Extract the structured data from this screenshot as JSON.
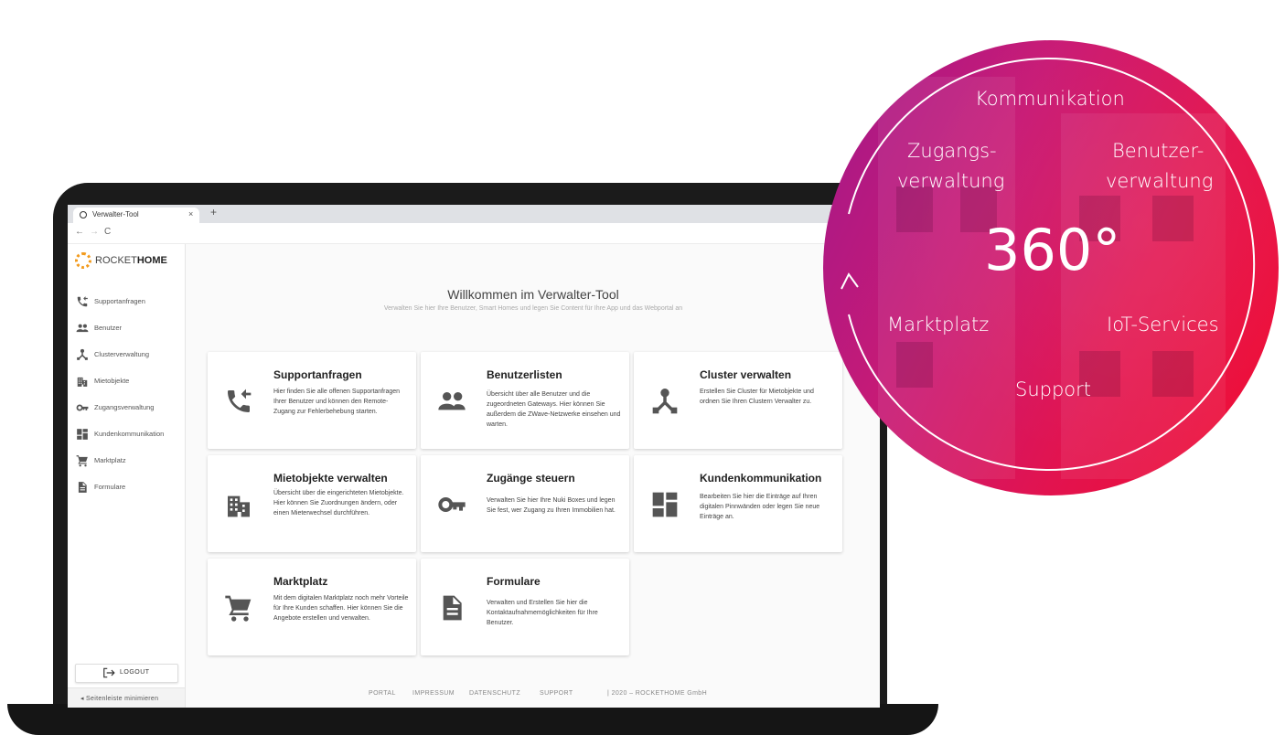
{
  "browser": {
    "tab_title": "Verwalter-Tool",
    "tab_close": "×",
    "new_tab": "+",
    "nav_back": "←",
    "nav_forward": "→",
    "nav_reload": "C"
  },
  "logo": {
    "part1": "ROCKET",
    "part2": "HOME",
    "mark_color": "#f29a1c"
  },
  "sidebar": {
    "items": [
      {
        "label": "Supportanfragen",
        "icon": "phone-forward-icon"
      },
      {
        "label": "Benutzer",
        "icon": "users-icon"
      },
      {
        "label": "Clusterverwaltung",
        "icon": "cluster-icon"
      },
      {
        "label": "Mietobjekte",
        "icon": "building-icon"
      },
      {
        "label": "Zugangsverwaltung",
        "icon": "key-icon"
      },
      {
        "label": "Kundenkommunikation",
        "icon": "dashboard-icon"
      },
      {
        "label": "Marktplatz",
        "icon": "cart-icon"
      },
      {
        "label": "Formulare",
        "icon": "document-icon"
      }
    ],
    "logout": "LOGOUT",
    "minimize": "◂  Seitenleiste minimieren"
  },
  "main": {
    "welcome_title": "Willkommen im Verwalter-Tool",
    "welcome_subtitle": "Verwalten Sie hier Ihre Benutzer, Smart Homes und legen Sie Content für Ihre App und das Webportal an",
    "cards": [
      {
        "title": "Supportanfragen",
        "text": "Hier finden Sie alle offenen Supportanfragen Ihrer Benutzer und können den Remote-Zugang zur Fehlerbehebung starten.",
        "icon": "phone-forward-icon"
      },
      {
        "title": "Benutzerlisten",
        "text": "Übersicht über alle Benutzer und die zugeordneten Gateways. Hier können Sie außerdem die ZWave-Netzwerke einsehen und warten.",
        "icon": "users-icon"
      },
      {
        "title": "Cluster verwalten",
        "text": "Erstellen Sie Cluster für Mietobjekte und ordnen Sie Ihren Clustern Verwalter zu.",
        "icon": "cluster-icon"
      },
      {
        "title": "Mietobjekte verwalten",
        "text": "Übersicht über die eingerichteten Mietobjekte. Hier können Sie Zuordnungen ändern, oder einen Mieterwechsel durchführen.",
        "icon": "building-icon"
      },
      {
        "title": "Zugänge steuern",
        "text": "Verwalten Sie hier Ihre Nuki Boxes und legen Sie fest, wer Zugang zu Ihren Immobilien hat.",
        "icon": "key-icon"
      },
      {
        "title": "Kundenkommunikation",
        "text": "Bearbeiten Sie hier die Einträge auf Ihren digitalen Pinnwänden oder legen Sie neue Einträge an.",
        "icon": "dashboard-icon"
      },
      {
        "title": "Marktplatz",
        "text": "Mit dem digitalen Marktplatz noch mehr Vorteile für Ihre Kunden schaffen. Hier können Sie die Angebote erstellen und verwalten.",
        "icon": "cart-icon"
      },
      {
        "title": "Formulare",
        "text": "Verwalten und Erstellen Sie hier die Kontaktaufnahmemöglichkeiten für Ihre Benutzer.",
        "icon": "document-icon"
      }
    ]
  },
  "footer": {
    "links": [
      "PORTAL",
      "IMPRESSUM",
      "DATENSCHUTZ",
      "SUPPORT"
    ],
    "copyright": "|  2020 – ROCKETHOME GmbH"
  },
  "circle": {
    "center": "360°",
    "labels": {
      "top": "Kommunikation",
      "left_line1": "Zugangs-",
      "left_line2": "verwaltung",
      "right_line1": "Benutzer-",
      "right_line2": "verwaltung",
      "mid_left": "Marktplatz",
      "mid_right": "IoT-Services",
      "bottom": "Support"
    },
    "gradient_colors": [
      "#a2188b",
      "#c81a75",
      "#e2134f",
      "#f20a2e"
    ]
  },
  "accent_color": "#b5136e"
}
